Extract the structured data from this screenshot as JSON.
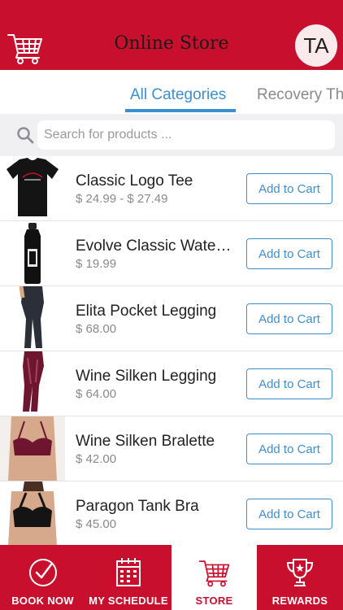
{
  "header": {
    "title": "Online Store",
    "avatar_initials": "TA",
    "icon": "shopping-cart-icon"
  },
  "tabs": [
    {
      "label": "All Categories",
      "active": true
    },
    {
      "label": "Recovery Th",
      "active": false
    }
  ],
  "search": {
    "placeholder": "Search for products ...",
    "value": ""
  },
  "products": [
    {
      "name": "Classic Logo Tee",
      "price": "$ 24.99 - $ 27.49",
      "button": "Add to Cart"
    },
    {
      "name": "Evolve Classic Wate…",
      "price": "$ 19.99",
      "button": "Add to Cart"
    },
    {
      "name": "Elita Pocket Legging",
      "price": "$ 68.00",
      "button": "Add to Cart"
    },
    {
      "name": "Wine Silken Legging",
      "price": "$ 64.00",
      "button": "Add to Cart"
    },
    {
      "name": "Wine Silken Bralette",
      "price": "$ 42.00",
      "button": "Add to Cart"
    },
    {
      "name": "Paragon Tank Bra",
      "price": "$ 45.00",
      "button": "Add to Cart"
    }
  ],
  "bottom_nav": [
    {
      "label": "BOOK NOW",
      "icon": "check-circle-icon",
      "active": false
    },
    {
      "label": "MY SCHEDULE",
      "icon": "calendar-icon",
      "active": false
    },
    {
      "label": "STORE",
      "icon": "shopping-cart-icon",
      "active": true
    },
    {
      "label": "REWARDS",
      "icon": "trophy-icon",
      "active": false
    }
  ],
  "colors": {
    "brand": "#c8102e",
    "accent": "#3d8fd1"
  }
}
